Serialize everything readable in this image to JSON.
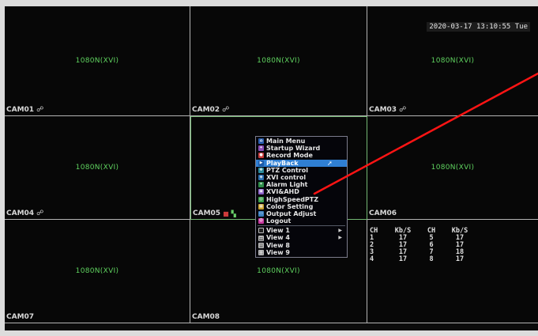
{
  "datetime": "2020-03-17 13:10:55 Tue",
  "channels": [
    {
      "label": "CAM01",
      "resolution": "1080N(XVI)",
      "icons": [
        "net-icon"
      ]
    },
    {
      "label": "CAM02",
      "resolution": "1080N(XVI)",
      "icons": [
        "net-icon"
      ]
    },
    {
      "label": "CAM03",
      "resolution": "1080N(XVI)",
      "icons": [
        "net-icon"
      ]
    },
    {
      "label": "CAM04",
      "resolution": "1080N(XVI)",
      "icons": [
        "net-icon"
      ]
    },
    {
      "label": "CAM05",
      "resolution": "",
      "icons": [
        "record-icon",
        "motion-icon"
      ]
    },
    {
      "label": "CAM06",
      "resolution": "1080N(XVI)",
      "icons": []
    },
    {
      "label": "CAM07",
      "resolution": "1080N(XVI)",
      "icons": []
    },
    {
      "label": "CAM08",
      "resolution": "1080N(XVI)",
      "icons": []
    }
  ],
  "context_menu": {
    "items": [
      {
        "label": "Main Menu",
        "icon": "main-menu-icon",
        "color": "#2a5fb0"
      },
      {
        "label": "Startup Wizard",
        "icon": "wizard-icon",
        "color": "#8a4fb8"
      },
      {
        "label": "Record Mode",
        "icon": "record-mode-icon",
        "color": "#c83a3a"
      },
      {
        "label": "PlayBack",
        "icon": "playback-icon",
        "color": "#2f7fd3",
        "active": true
      },
      {
        "label": "PTZ Control",
        "icon": "ptz-icon",
        "color": "#2a8a9c"
      },
      {
        "label": "XVI control",
        "icon": "xvi-icon",
        "color": "#2a6fb0"
      },
      {
        "label": "Alarm Light",
        "icon": "alarm-light-icon",
        "color": "#2f8f4a"
      },
      {
        "label": "XVI&AHD",
        "icon": "xvi-ahd-icon",
        "color": "#8a5fc8"
      },
      {
        "label": "HighSpeedPTZ",
        "icon": "high-speed-ptz-icon",
        "color": "#3aa04a"
      },
      {
        "label": "Color Setting",
        "icon": "color-setting-icon",
        "color": "#c8a02a"
      },
      {
        "label": "Output Adjust",
        "icon": "output-adjust-icon",
        "color": "#3a7fc0"
      },
      {
        "label": "Logout",
        "icon": "logout-icon",
        "color": "#c83aa0"
      }
    ],
    "views": [
      {
        "label": "View 1",
        "icon": "view-1-icon",
        "submenu": true
      },
      {
        "label": "View 4",
        "icon": "view-4-icon",
        "submenu": true
      },
      {
        "label": "View 8",
        "icon": "view-8-icon",
        "submenu": false
      },
      {
        "label": "View 9",
        "icon": "view-9-icon",
        "submenu": false
      }
    ]
  },
  "bitrate": {
    "headers": [
      "CH",
      "Kb/S",
      "CH",
      "Kb/S"
    ],
    "rows": [
      [
        "1",
        "17",
        "5",
        "17"
      ],
      [
        "2",
        "17",
        "6",
        "17"
      ],
      [
        "3",
        "17",
        "7",
        "18"
      ],
      [
        "4",
        "17",
        "8",
        "17"
      ]
    ]
  },
  "colors": {
    "resolution_text": "#5fd25f",
    "menu_highlight": "#2f7fd3",
    "laser_pointer": "#ff1414"
  }
}
